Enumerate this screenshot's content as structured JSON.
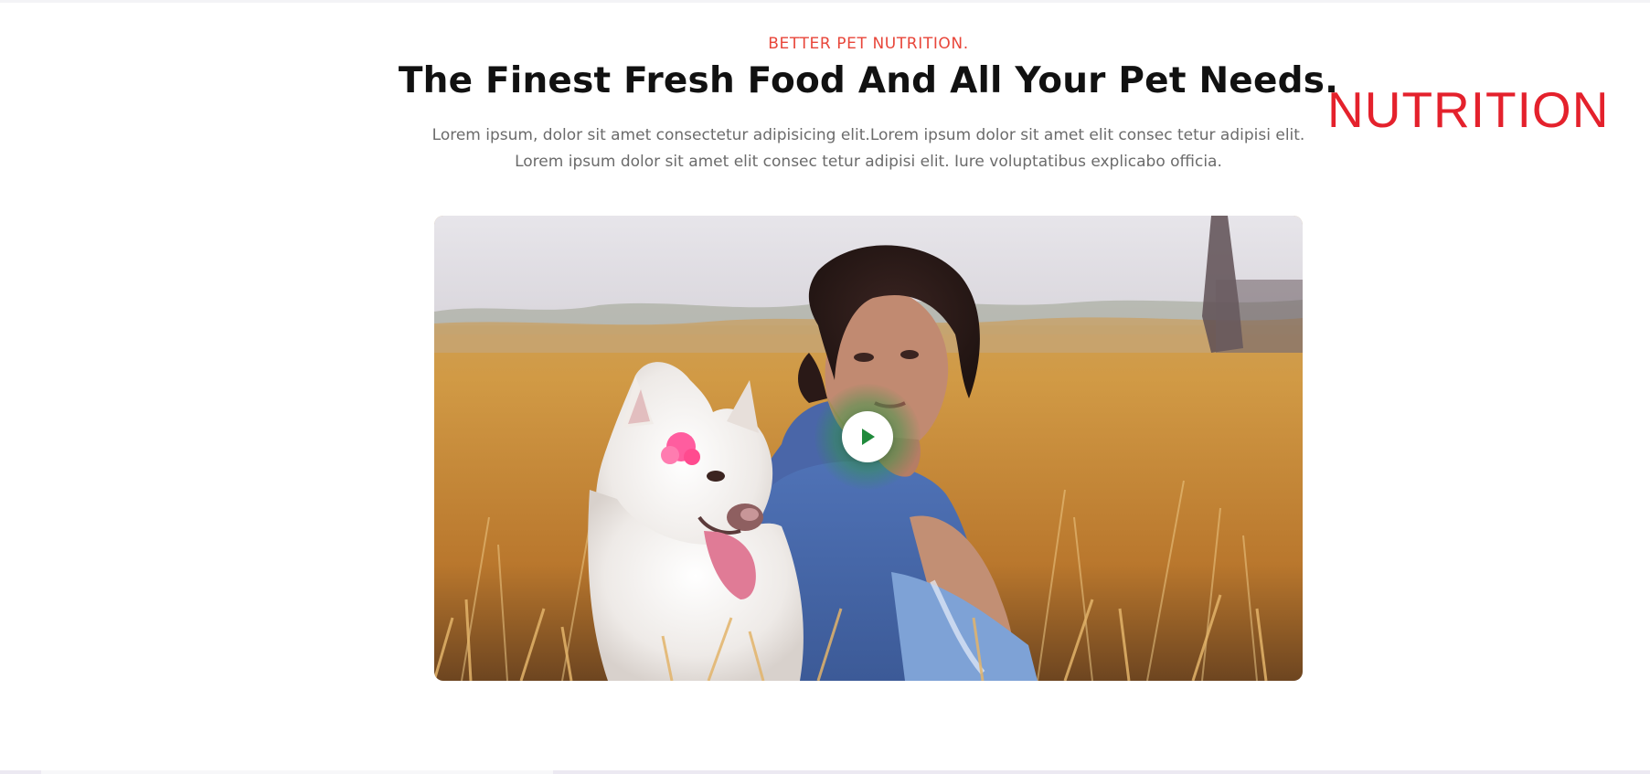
{
  "section": {
    "eyebrow": "BETTER PET NUTRITION.",
    "headline": "The Finest Fresh Food And All Your Pet Needs.",
    "description_line1": "Lorem ipsum, dolor sit amet consectetur adipisicing elit.Lorem ipsum dolor sit amet elit consec tetur adipisi elit.",
    "description_line2": "Lorem ipsum dolor sit amet elit consec tetur adipisi elit. Iure voluptatibus explicabo officia."
  },
  "overlay_tag": {
    "text": "NUTRITION",
    "color": "#e4212c"
  },
  "video": {
    "play_icon": "play-icon",
    "accent_color": "#1f8a3b"
  },
  "colors": {
    "eyebrow": "#e8463a",
    "headline": "#111111",
    "body_text": "#6b6b6b"
  }
}
